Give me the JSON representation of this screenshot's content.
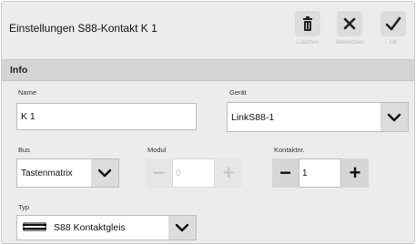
{
  "dialog": {
    "title": "Einstellungen S88-Kontakt K 1"
  },
  "toolbar": {
    "delete_label": "Löschen",
    "cancel_label": "Abbrechen",
    "ok_label": "Ok",
    "delete_icon": "trash-icon",
    "cancel_icon": "close-icon",
    "ok_icon": "checkmark-icon"
  },
  "section": {
    "title": "Info"
  },
  "fields": {
    "name": {
      "label": "Name",
      "value": "K 1"
    },
    "device": {
      "label": "Gerät",
      "value": "LinkS88-1"
    },
    "bus": {
      "label": "Bus",
      "value": "Tastenmatrix"
    },
    "module": {
      "label": "Modul",
      "value": "0",
      "disabled": true
    },
    "contact": {
      "label": "Kontaktnr.",
      "value": "1"
    },
    "type": {
      "label": "Typ",
      "value": "S88 Kontaktgleis",
      "icon": "track-icon"
    }
  }
}
